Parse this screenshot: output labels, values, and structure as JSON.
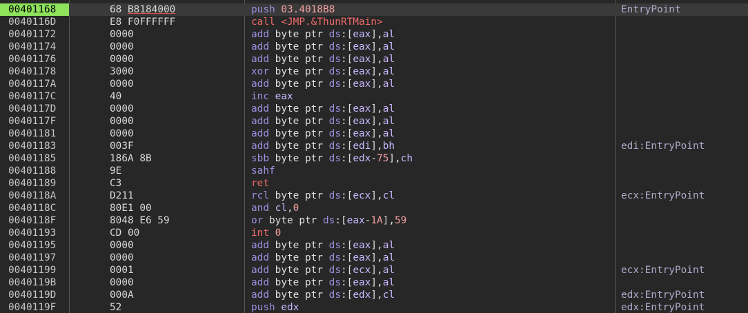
{
  "rows": [
    {
      "addr": "00401168",
      "bytes": "68 B8184000",
      "asm": "push 03.4018B8",
      "comment": "EntryPoint",
      "selected": true
    },
    {
      "addr": "0040116D",
      "bytes": "E8 F0FFFFFF",
      "asm": "call <JMP.&ThunRTMain>",
      "comment": ""
    },
    {
      "addr": "00401172",
      "bytes": "0000",
      "asm": "add byte ptr ds:[eax],al",
      "comment": ""
    },
    {
      "addr": "00401174",
      "bytes": "0000",
      "asm": "add byte ptr ds:[eax],al",
      "comment": ""
    },
    {
      "addr": "00401176",
      "bytes": "0000",
      "asm": "add byte ptr ds:[eax],al",
      "comment": ""
    },
    {
      "addr": "00401178",
      "bytes": "3000",
      "asm": "xor byte ptr ds:[eax],al",
      "comment": ""
    },
    {
      "addr": "0040117A",
      "bytes": "0000",
      "asm": "add byte ptr ds:[eax],al",
      "comment": ""
    },
    {
      "addr": "0040117C",
      "bytes": "40",
      "asm": "inc eax",
      "comment": ""
    },
    {
      "addr": "0040117D",
      "bytes": "0000",
      "asm": "add byte ptr ds:[eax],al",
      "comment": ""
    },
    {
      "addr": "0040117F",
      "bytes": "0000",
      "asm": "add byte ptr ds:[eax],al",
      "comment": ""
    },
    {
      "addr": "00401181",
      "bytes": "0000",
      "asm": "add byte ptr ds:[eax],al",
      "comment": ""
    },
    {
      "addr": "00401183",
      "bytes": "003F",
      "asm": "add byte ptr ds:[edi],bh",
      "comment": "edi:EntryPoint"
    },
    {
      "addr": "00401185",
      "bytes": "186A 8B",
      "asm": "sbb byte ptr ds:[edx-75],ch",
      "comment": ""
    },
    {
      "addr": "00401188",
      "bytes": "9E",
      "asm": "sahf",
      "comment": ""
    },
    {
      "addr": "00401189",
      "bytes": "C3",
      "asm": "ret",
      "comment": ""
    },
    {
      "addr": "0040118A",
      "bytes": "D211",
      "asm": "rcl byte ptr ds:[ecx],cl",
      "comment": "ecx:EntryPoint"
    },
    {
      "addr": "0040118C",
      "bytes": "80E1 00",
      "asm": "and cl,0",
      "comment": ""
    },
    {
      "addr": "0040118F",
      "bytes": "8048 E6 59",
      "asm": "or byte ptr ds:[eax-1A],59",
      "comment": ""
    },
    {
      "addr": "00401193",
      "bytes": "CD 00",
      "asm": "int 0",
      "comment": ""
    },
    {
      "addr": "00401195",
      "bytes": "0000",
      "asm": "add byte ptr ds:[eax],al",
      "comment": ""
    },
    {
      "addr": "00401197",
      "bytes": "0000",
      "asm": "add byte ptr ds:[eax],al",
      "comment": ""
    },
    {
      "addr": "00401199",
      "bytes": "0001",
      "asm": "add byte ptr ds:[ecx],al",
      "comment": "ecx:EntryPoint"
    },
    {
      "addr": "0040119B",
      "bytes": "0000",
      "asm": "add byte ptr ds:[eax],al",
      "comment": ""
    },
    {
      "addr": "0040119D",
      "bytes": "000A",
      "asm": "add byte ptr ds:[edx],cl",
      "comment": "edx:EntryPoint"
    },
    {
      "addr": "0040119F",
      "bytes": "52",
      "asm": "push edx",
      "comment": "edx:EntryPoint",
      "partial": true
    }
  ],
  "colors": {
    "background": "#272727",
    "selection": "#8ee25c",
    "separator": "#565656"
  }
}
